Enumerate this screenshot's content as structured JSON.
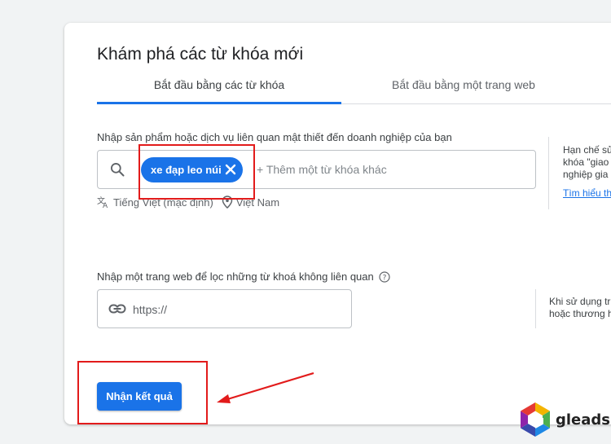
{
  "header": {
    "title": "Khám phá các từ khóa mới"
  },
  "tabs": [
    {
      "label": "Bắt đầu bằng các từ khóa"
    },
    {
      "label": "Bắt đầu bằng một trang web"
    }
  ],
  "keywords": {
    "label": "Nhập sản phẩm hoặc dịch vụ liên quan mật thiết đến doanh nghiệp của bạn",
    "chip": "xe đạp leo núi",
    "placeholder": "+ Thêm một từ khóa khác",
    "language": "Tiếng Việt (mặc định)",
    "location": "Việt Nam"
  },
  "side_keywords": {
    "line1": "Hạn chế sử",
    "line2": "khóa \"giao",
    "line3": "nghiệp gia",
    "link": "Tìm hiểu th"
  },
  "website": {
    "label": "Nhập một trang web để lọc những từ khoá không liên quan",
    "placeholder": "https://"
  },
  "side_website": {
    "line1": "Khi sử dụng tr",
    "line2": "hoặc thương h"
  },
  "submit": {
    "label": "Nhận kết quả"
  },
  "logo": {
    "text": "gleads"
  },
  "colors": {
    "accent": "#1a73e8",
    "highlight": "#e21b1b"
  }
}
